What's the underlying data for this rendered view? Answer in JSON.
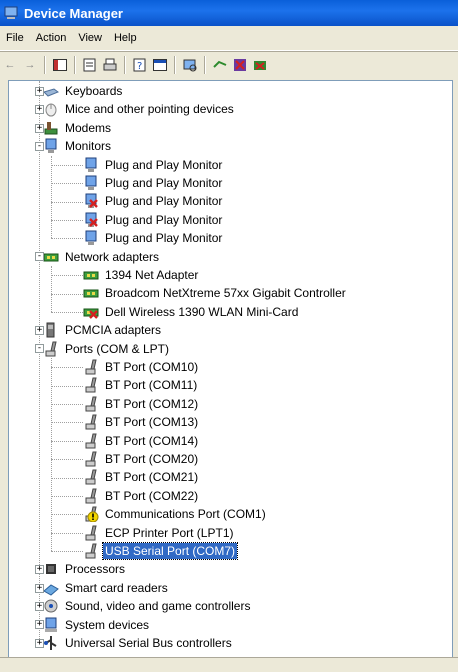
{
  "window": {
    "title": "Device Manager"
  },
  "menu": [
    "File",
    "Action",
    "View",
    "Help"
  ],
  "toolbar": [
    "back-arrow-icon",
    "forward-arrow-icon",
    "show-hide-tree-icon",
    "properties-icon",
    "print-icon",
    "help-icon",
    "console-tree-icon",
    "scan-hardware-icon",
    "update-driver-icon",
    "uninstall-icon",
    "disable-icon"
  ],
  "colors": {
    "title_bar": "#0A5FD9",
    "selection": "#316AC5",
    "window_bg": "#ECE9D8",
    "error_mark": "#D42020",
    "warning_mark": "#F2D600"
  },
  "tree": [
    {
      "label": "Keyboards",
      "level": 0,
      "expander": "+",
      "icon": "keyboard-icon"
    },
    {
      "label": "Mice and other pointing devices",
      "level": 0,
      "expander": "+",
      "icon": "mouse-icon"
    },
    {
      "label": "Modems",
      "level": 0,
      "expander": "+",
      "icon": "modem-icon"
    },
    {
      "label": "Monitors",
      "level": 0,
      "expander": "-",
      "icon": "monitor-icon"
    },
    {
      "label": "Plug and Play Monitor",
      "level": 1,
      "icon": "monitor-icon"
    },
    {
      "label": "Plug and Play Monitor",
      "level": 1,
      "icon": "monitor-icon"
    },
    {
      "label": "Plug and Play Monitor",
      "level": 1,
      "icon": "monitor-disabled-icon"
    },
    {
      "label": "Plug and Play Monitor",
      "level": 1,
      "icon": "monitor-disabled-icon"
    },
    {
      "label": "Plug and Play Monitor",
      "level": 1,
      "icon": "monitor-icon"
    },
    {
      "label": "Network adapters",
      "level": 0,
      "expander": "-",
      "icon": "network-card-icon"
    },
    {
      "label": "1394 Net Adapter",
      "level": 1,
      "icon": "network-card-icon"
    },
    {
      "label": "Broadcom NetXtreme 57xx Gigabit Controller",
      "level": 1,
      "icon": "network-card-icon"
    },
    {
      "label": "Dell Wireless 1390 WLAN Mini-Card",
      "level": 1,
      "icon": "network-card-disabled-icon"
    },
    {
      "label": "PCMCIA adapters",
      "level": 0,
      "expander": "+",
      "icon": "pcmcia-icon"
    },
    {
      "label": "Ports (COM & LPT)",
      "level": 0,
      "expander": "-",
      "icon": "port-icon"
    },
    {
      "label": "BT Port (COM10)",
      "level": 1,
      "icon": "port-icon"
    },
    {
      "label": "BT Port (COM11)",
      "level": 1,
      "icon": "port-icon"
    },
    {
      "label": "BT Port (COM12)",
      "level": 1,
      "icon": "port-icon"
    },
    {
      "label": "BT Port (COM13)",
      "level": 1,
      "icon": "port-icon"
    },
    {
      "label": "BT Port (COM14)",
      "level": 1,
      "icon": "port-icon"
    },
    {
      "label": "BT Port (COM20)",
      "level": 1,
      "icon": "port-icon"
    },
    {
      "label": "BT Port (COM21)",
      "level": 1,
      "icon": "port-icon"
    },
    {
      "label": "BT Port (COM22)",
      "level": 1,
      "icon": "port-icon"
    },
    {
      "label": "Communications Port (COM1)",
      "level": 1,
      "icon": "port-warning-icon"
    },
    {
      "label": "ECP Printer Port (LPT1)",
      "level": 1,
      "icon": "port-icon"
    },
    {
      "label": "USB Serial Port (COM7)",
      "level": 1,
      "icon": "port-icon",
      "selected": true
    },
    {
      "label": "Processors",
      "level": 0,
      "expander": "+",
      "icon": "processor-icon"
    },
    {
      "label": "Smart card readers",
      "level": 0,
      "expander": "+",
      "icon": "smart-card-icon"
    },
    {
      "label": "Sound, video and game controllers",
      "level": 0,
      "expander": "+",
      "icon": "sound-icon"
    },
    {
      "label": "System devices",
      "level": 0,
      "expander": "+",
      "icon": "system-icon"
    },
    {
      "label": "Universal Serial Bus controllers",
      "level": 0,
      "expander": "+",
      "icon": "usb-icon"
    }
  ]
}
